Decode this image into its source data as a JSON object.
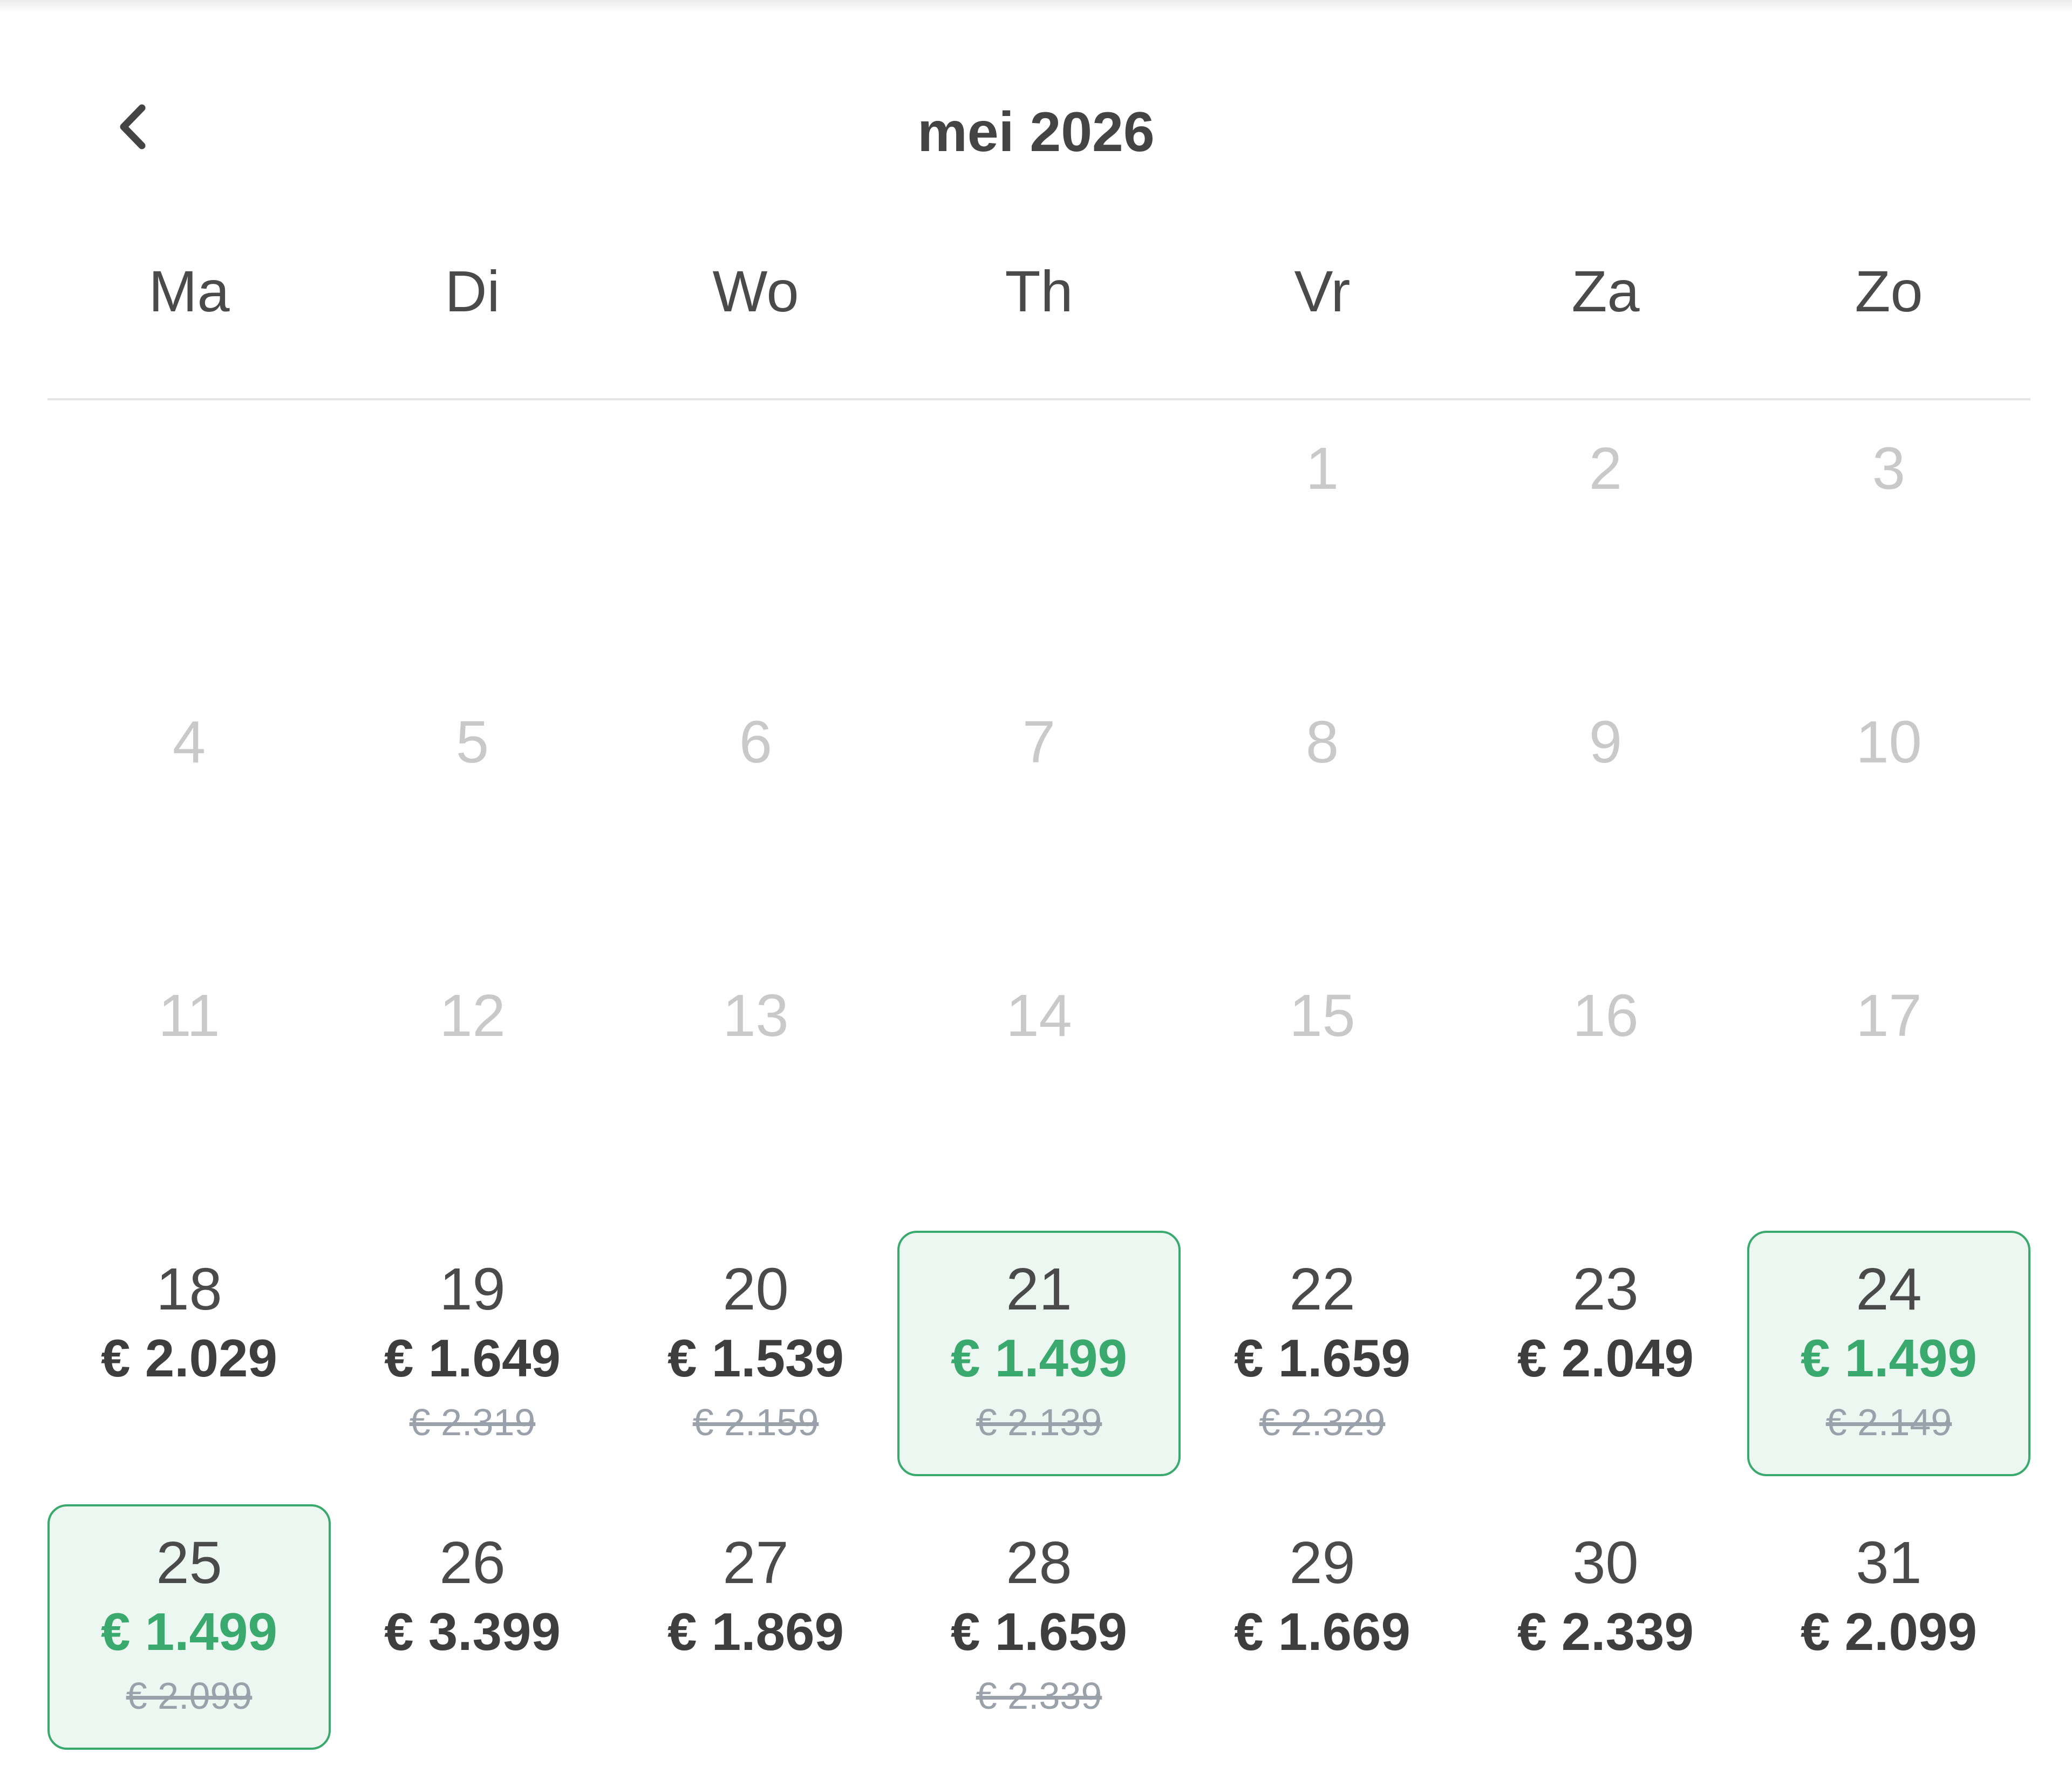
{
  "header": {
    "title": "mei 2026",
    "prev_icon": "chevron-left-icon"
  },
  "weekdays": [
    "Ma",
    "Di",
    "Wo",
    "Th",
    "Vr",
    "Za",
    "Zo"
  ],
  "colors": {
    "accent": "#3aa96d",
    "highlight_bg": "#edf7f1",
    "muted_text": "#c9c9c9",
    "strike_text": "#9ba1aa"
  },
  "days": [
    {
      "day": "",
      "empty": true
    },
    {
      "day": "",
      "empty": true
    },
    {
      "day": "",
      "empty": true
    },
    {
      "day": "",
      "empty": true
    },
    {
      "day": "1",
      "muted": true
    },
    {
      "day": "2",
      "muted": true
    },
    {
      "day": "3",
      "muted": true
    },
    {
      "day": "4",
      "muted": true
    },
    {
      "day": "5",
      "muted": true
    },
    {
      "day": "6",
      "muted": true
    },
    {
      "day": "7",
      "muted": true
    },
    {
      "day": "8",
      "muted": true
    },
    {
      "day": "9",
      "muted": true
    },
    {
      "day": "10",
      "muted": true
    },
    {
      "day": "11",
      "muted": true
    },
    {
      "day": "12",
      "muted": true
    },
    {
      "day": "13",
      "muted": true
    },
    {
      "day": "14",
      "muted": true
    },
    {
      "day": "15",
      "muted": true
    },
    {
      "day": "16",
      "muted": true
    },
    {
      "day": "17",
      "muted": true
    },
    {
      "day": "18",
      "price": "€ 2.029"
    },
    {
      "day": "19",
      "price": "€ 1.649",
      "old_price": "€ 2.319"
    },
    {
      "day": "20",
      "price": "€ 1.539",
      "old_price": "€ 2.159"
    },
    {
      "day": "21",
      "price": "€ 1.499",
      "old_price": "€ 2.139",
      "highlight": true
    },
    {
      "day": "22",
      "price": "€ 1.659",
      "old_price": "€ 2.329"
    },
    {
      "day": "23",
      "price": "€ 2.049"
    },
    {
      "day": "24",
      "price": "€ 1.499",
      "old_price": "€ 2.149",
      "highlight": true
    },
    {
      "day": "25",
      "price": "€ 1.499",
      "old_price": "€ 2.099",
      "highlight": true
    },
    {
      "day": "26",
      "price": "€ 3.399"
    },
    {
      "day": "27",
      "price": "€ 1.869"
    },
    {
      "day": "28",
      "price": "€ 1.659",
      "old_price": "€ 2.339"
    },
    {
      "day": "29",
      "price": "€ 1.669"
    },
    {
      "day": "30",
      "price": "€ 2.339"
    },
    {
      "day": "31",
      "price": "€ 2.099"
    }
  ]
}
